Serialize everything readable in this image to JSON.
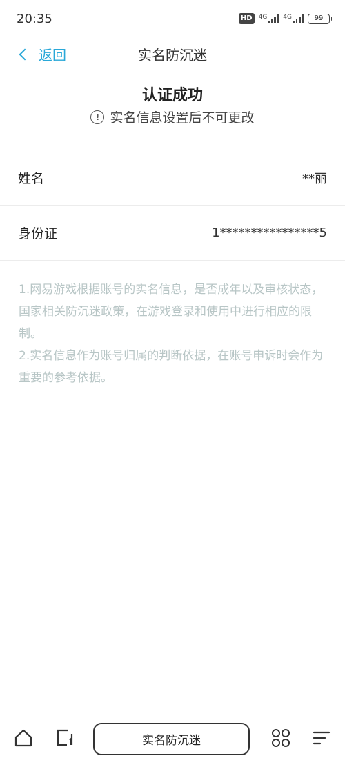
{
  "status_bar": {
    "time": "20:35",
    "hd_badge": "HD",
    "network_1": "4G",
    "network_2": "4G",
    "battery": "99"
  },
  "nav": {
    "back_label": "返回",
    "title": "实名防沉迷"
  },
  "header": {
    "title": "认证成功",
    "notice": "实名信息设置后不可更改",
    "notice_icon": "info-circle-icon"
  },
  "fields": [
    {
      "label": "姓名",
      "value": "**丽"
    },
    {
      "label": "身份证",
      "value": "1****************5"
    }
  ],
  "notes": [
    "1.网易游戏根据账号的实名信息，是否成年以及审核状态，国家相关防沉迷政策，在游戏登录和使用中进行相应的限制。",
    "2.实名信息作为账号归属的判断依据，在账号申诉时会作为重要的参考依据。"
  ],
  "bottom_bar": {
    "app_label": "实名防沉迷",
    "icons": [
      "home-icon",
      "tabs-icon",
      "apps-grid-icon",
      "menu-icon"
    ]
  },
  "colors": {
    "accent": "#29a8d8",
    "note_text": "#b8c6c6",
    "divider": "#ececec"
  }
}
